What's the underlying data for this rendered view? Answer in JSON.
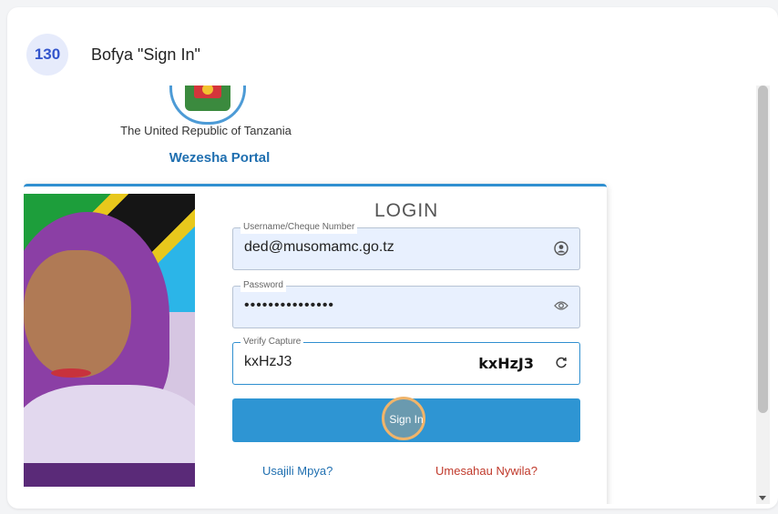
{
  "step": {
    "number": "130",
    "instruction": "Bofya \"Sign In\""
  },
  "header": {
    "republic": "The United Republic of Tanzania",
    "portal_name": "Wezesha Portal"
  },
  "login": {
    "title": "LOGIN",
    "username": {
      "label": "Username/Cheque Number",
      "value": "ded@musomamc.go.tz",
      "icon": "user-circle-icon"
    },
    "password": {
      "label": "Password",
      "value": "•••••••••••••••",
      "icon": "eye-icon"
    },
    "captcha": {
      "label": "Verify Capture",
      "value": "kxHzJ3",
      "code": "kxHzJ3",
      "icon": "refresh-icon"
    },
    "signin_label": "Sign In",
    "register_link": "Usajili Mpya?",
    "forgot_link": "Umesahau Nywila?"
  },
  "colors": {
    "accent": "#2e95d3",
    "link": "#1f6fb0",
    "danger": "#c0392b",
    "badge": "#3355cc"
  }
}
